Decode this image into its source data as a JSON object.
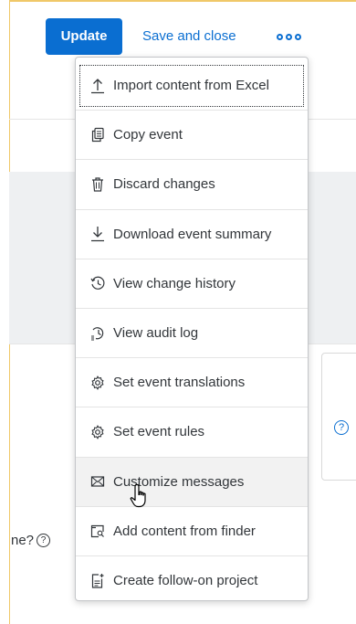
{
  "header": {
    "update_label": "Update",
    "save_close_label": "Save and close",
    "more_icon": "more-horizontal-icon"
  },
  "menu": {
    "items": [
      {
        "label": "Import content from Excel",
        "icon": "upload-icon"
      },
      {
        "label": "Copy event",
        "icon": "copy-icon"
      },
      {
        "label": "Discard changes",
        "icon": "trash-icon"
      },
      {
        "label": "Download event summary",
        "icon": "download-icon"
      },
      {
        "label": "View change history",
        "icon": "history-icon"
      },
      {
        "label": "View audit log",
        "icon": "audit-log-icon"
      },
      {
        "label": "Set event translations",
        "icon": "gear-icon"
      },
      {
        "label": "Set event rules",
        "icon": "gear-icon"
      },
      {
        "label": "Customize messages",
        "icon": "envelope-icon"
      },
      {
        "label": "Add content from finder",
        "icon": "finder-icon"
      },
      {
        "label": "Create follow-on project",
        "icon": "new-document-icon"
      }
    ]
  },
  "background": {
    "question_fragment": "ne?",
    "help_glyph": "?"
  },
  "colors": {
    "accent": "#0a6ed1",
    "border_accent": "#f0c869"
  }
}
